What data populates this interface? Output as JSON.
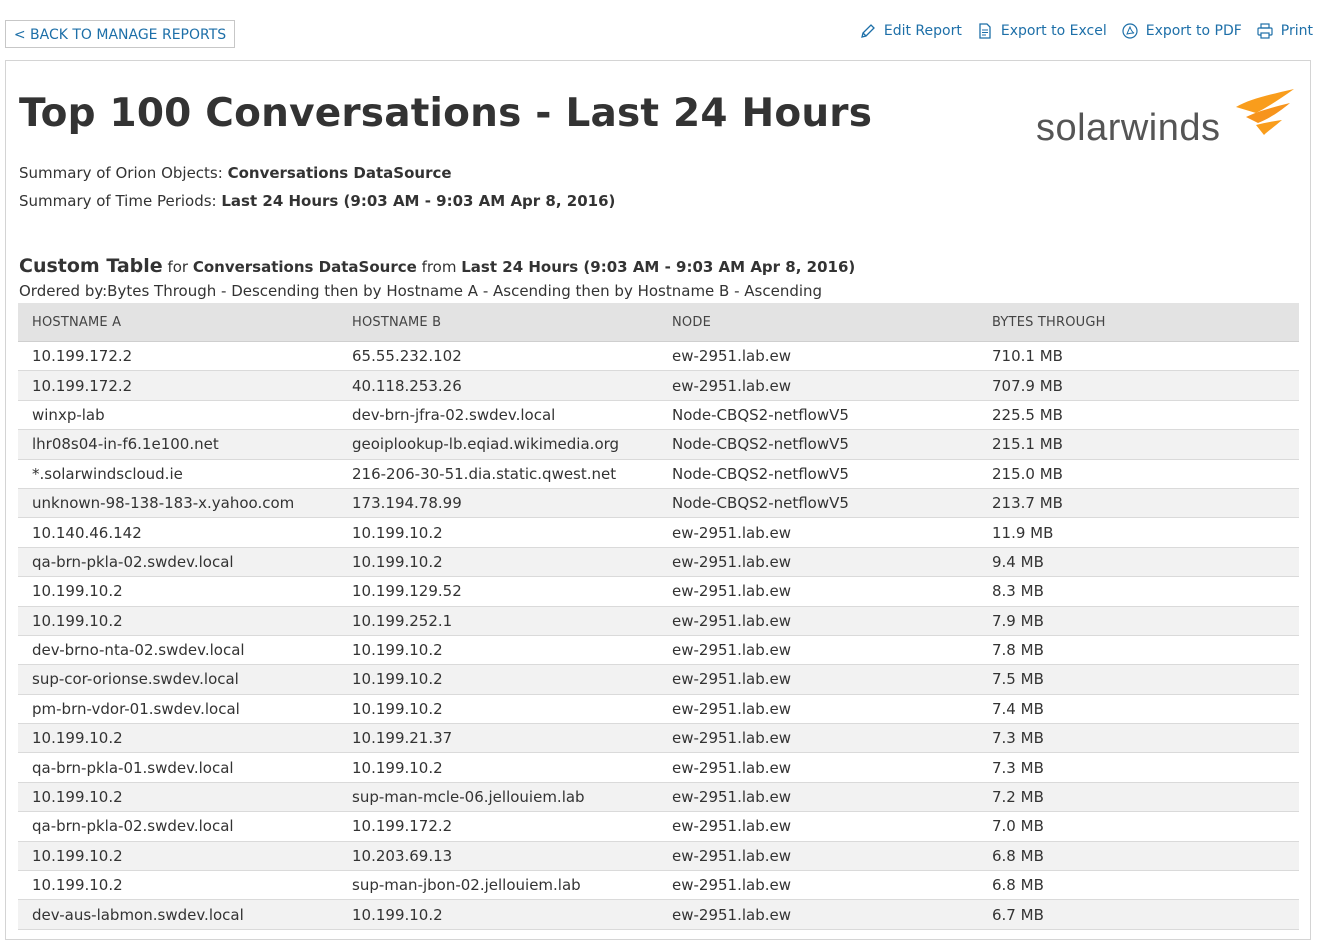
{
  "nav": {
    "back_label": "< BACK TO MANAGE REPORTS",
    "actions": [
      {
        "label": "Edit Report",
        "icon": "pencil-icon"
      },
      {
        "label": "Export to Excel",
        "icon": "excel-doc-icon"
      },
      {
        "label": "Export to PDF",
        "icon": "pdf-icon"
      },
      {
        "label": "Print",
        "icon": "printer-icon"
      }
    ]
  },
  "report": {
    "title": "Top 100 Conversations - Last 24 Hours",
    "logo_text": "solarwinds",
    "summary_objects_label": "Summary of Orion Objects: ",
    "summary_objects_value": "Conversations DataSource",
    "summary_time_label": "Summary of Time Periods: ",
    "summary_time_value": "Last 24 Hours (9:03 AM - 9:03 AM Apr 8, 2016)"
  },
  "custom_table": {
    "heading": "Custom Table",
    "for_text": " for ",
    "source": "Conversations DataSource",
    "from_text": " from ",
    "period": "Last 24 Hours (9:03 AM - 9:03 AM Apr 8, 2016)",
    "ordered_by": "Ordered by:Bytes Through - Descending then by Hostname A - Ascending then by Hostname B - Ascending",
    "columns": [
      "HOSTNAME A",
      "HOSTNAME B",
      "NODE",
      "BYTES THROUGH"
    ],
    "rows": [
      [
        "10.199.172.2",
        "65.55.232.102",
        "ew-2951.lab.ew",
        "710.1 MB"
      ],
      [
        "10.199.172.2",
        "40.118.253.26",
        "ew-2951.lab.ew",
        "707.9 MB"
      ],
      [
        "winxp-lab",
        "dev-brn-jfra-02.swdev.local",
        "Node-CBQS2-netflowV5",
        "225.5 MB"
      ],
      [
        "lhr08s04-in-f6.1e100.net",
        "geoiplookup-lb.eqiad.wikimedia.org",
        "Node-CBQS2-netflowV5",
        "215.1 MB"
      ],
      [
        "*.solarwindscloud.ie",
        "216-206-30-51.dia.static.qwest.net",
        "Node-CBQS2-netflowV5",
        "215.0 MB"
      ],
      [
        "unknown-98-138-183-x.yahoo.com",
        "173.194.78.99",
        "Node-CBQS2-netflowV5",
        "213.7 MB"
      ],
      [
        "10.140.46.142",
        "10.199.10.2",
        "ew-2951.lab.ew",
        "11.9 MB"
      ],
      [
        "qa-brn-pkla-02.swdev.local",
        "10.199.10.2",
        "ew-2951.lab.ew",
        "9.4 MB"
      ],
      [
        "10.199.10.2",
        "10.199.129.52",
        "ew-2951.lab.ew",
        "8.3 MB"
      ],
      [
        "10.199.10.2",
        "10.199.252.1",
        "ew-2951.lab.ew",
        "7.9 MB"
      ],
      [
        "dev-brno-nta-02.swdev.local",
        "10.199.10.2",
        "ew-2951.lab.ew",
        "7.8 MB"
      ],
      [
        "sup-cor-orionse.swdev.local",
        "10.199.10.2",
        "ew-2951.lab.ew",
        "7.5 MB"
      ],
      [
        "pm-brn-vdor-01.swdev.local",
        "10.199.10.2",
        "ew-2951.lab.ew",
        "7.4 MB"
      ],
      [
        "10.199.10.2",
        "10.199.21.37",
        "ew-2951.lab.ew",
        "7.3 MB"
      ],
      [
        "qa-brn-pkla-01.swdev.local",
        "10.199.10.2",
        "ew-2951.lab.ew",
        "7.3 MB"
      ],
      [
        "10.199.10.2",
        "sup-man-mcle-06.jellouiem.lab",
        "ew-2951.lab.ew",
        "7.2 MB"
      ],
      [
        "qa-brn-pkla-02.swdev.local",
        "10.199.172.2",
        "ew-2951.lab.ew",
        "7.0 MB"
      ],
      [
        "10.199.10.2",
        "10.203.69.13",
        "ew-2951.lab.ew",
        "6.8 MB"
      ],
      [
        "10.199.10.2",
        "sup-man-jbon-02.jellouiem.lab",
        "ew-2951.lab.ew",
        "6.8 MB"
      ],
      [
        "dev-aus-labmon.swdev.local",
        "10.199.10.2",
        "ew-2951.lab.ew",
        "6.7 MB"
      ]
    ]
  },
  "colors": {
    "link": "#1d6fa8",
    "header_bg": "#e3e3e3",
    "stripe_bg": "#f2f2f2",
    "logo_orange": "#f99d1c"
  }
}
